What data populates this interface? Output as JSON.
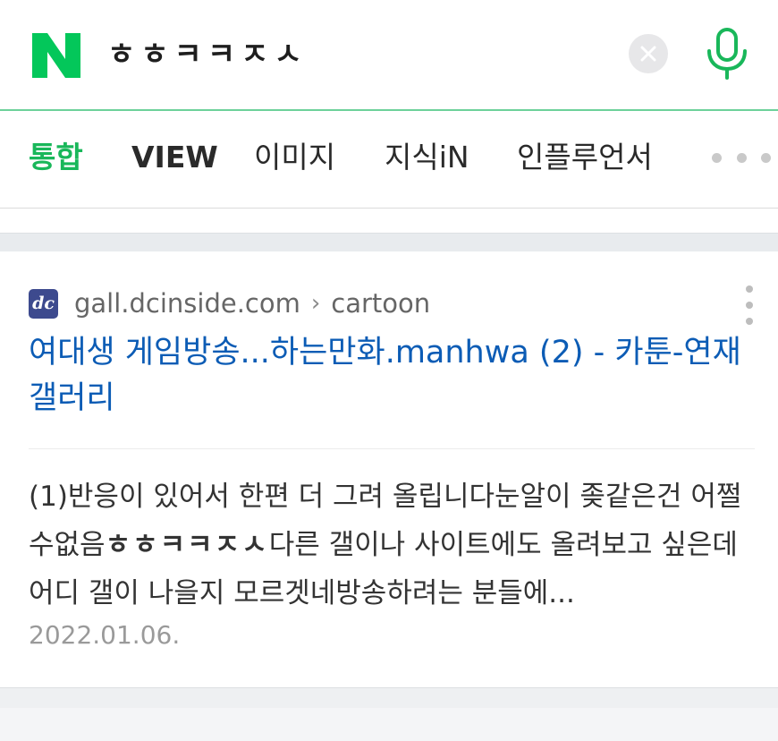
{
  "header": {
    "logo_letter": "N",
    "query": "ㅎㅎㅋㅋㅈㅅ",
    "brand_color": "#03c75a",
    "clear_icon": "close-icon",
    "mic_icon": "microphone-icon"
  },
  "tabs": [
    {
      "label": "통합",
      "active": true
    },
    {
      "label": "VIEW",
      "active": false
    },
    {
      "label": "이미지",
      "active": false
    },
    {
      "label": "지식iN",
      "active": false
    },
    {
      "label": "인플루언서",
      "active": false
    }
  ],
  "result": {
    "favicon_text": "dc",
    "domain": "gall.dcinside.com",
    "separator": "›",
    "path": "cartoon",
    "title": "여대생 게임방송...하는만화.manhwa (2) - 카툰-연재 갤러리",
    "snippet_before": "(1)반응이 있어서 한편 더 그려 올립니다눈알이 좆같은건 어쩔수없음",
    "snippet_highlight": "ㅎㅎㅋㅋㅈㅅ",
    "snippet_after": "다른 갤이나 사이트에도 올려보고 싶은데 어디 갤이 나을지 모르겟네방송하려는 분들에...",
    "date": "2022.01.06.",
    "title_color": "#0c5cb5"
  }
}
